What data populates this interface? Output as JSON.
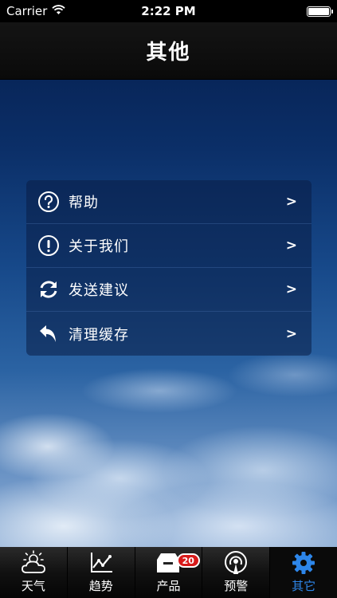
{
  "status_bar": {
    "carrier": "Carrier",
    "time": "2:22 PM",
    "battery_level": 1.0
  },
  "nav": {
    "title": "其他"
  },
  "menu": {
    "items": [
      {
        "label": "帮助",
        "icon": "help-icon",
        "arrow": ">"
      },
      {
        "label": "关于我们",
        "icon": "info-icon",
        "arrow": ">"
      },
      {
        "label": "发送建议",
        "icon": "refresh-icon",
        "arrow": ">"
      },
      {
        "label": "清理缓存",
        "icon": "undo-icon",
        "arrow": ">"
      }
    ]
  },
  "tabs": [
    {
      "label": "天气",
      "icon": "weather-icon",
      "active": false
    },
    {
      "label": "趋势",
      "icon": "trend-chart-icon",
      "active": false
    },
    {
      "label": "产品",
      "icon": "product-box-icon",
      "active": false,
      "badge": "20"
    },
    {
      "label": "预警",
      "icon": "alert-broadcast-icon",
      "active": false
    },
    {
      "label": "其它",
      "icon": "gear-icon",
      "active": true
    }
  ],
  "colors": {
    "active_tab": "#2d86ea",
    "badge": "#d81b1b"
  }
}
